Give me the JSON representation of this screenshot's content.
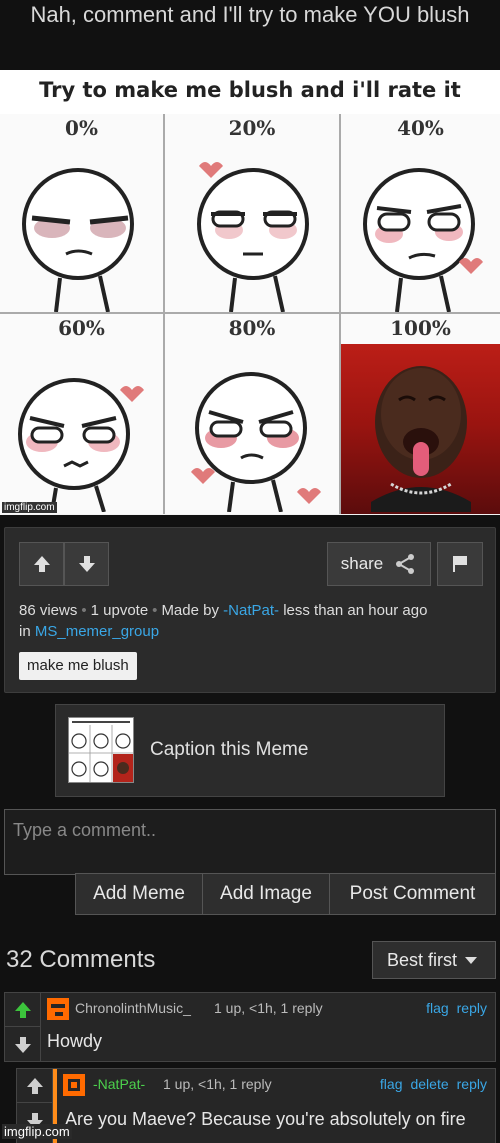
{
  "post": {
    "title": "Nah, comment and I'll try to make YOU blush"
  },
  "meme": {
    "header": "Try to make me blush and i'll rate it",
    "cells": [
      {
        "pct": "0%"
      },
      {
        "pct": "20%"
      },
      {
        "pct": "40%"
      },
      {
        "pct": "60%"
      },
      {
        "pct": "80%"
      },
      {
        "pct": "100%"
      }
    ],
    "watermark": "imgflip.com"
  },
  "info": {
    "share_label": "share",
    "views": "86 views",
    "upvotes": "1 upvote",
    "made_by_prefix": "Made by",
    "author": "-NatPat-",
    "time": "less than an hour ago",
    "in_prefix": "in",
    "group": "MS_memer_group",
    "tag": "make me blush"
  },
  "caption": {
    "label": "Caption this Meme"
  },
  "comment_form": {
    "placeholder": "Type a comment..",
    "add_meme": "Add Meme",
    "add_image": "Add Image",
    "post_comment": "Post Comment"
  },
  "comments_header": {
    "count_label": "32 Comments",
    "sort_value": "Best first"
  },
  "comments": [
    {
      "user": "ChronolinthMusic_",
      "stats": "1 up, <1h, 1 reply",
      "links": [
        "flag",
        "reply"
      ],
      "text": "Howdy",
      "user_color": "#bbbbbb",
      "avatar_color": "#ff6a00"
    },
    {
      "user": "-NatPat-",
      "stats": "1 up, <1h, 1 reply",
      "links": [
        "flag",
        "delete",
        "reply"
      ],
      "text": "Are you Maeve? Because you're absolutely on fire",
      "user_color": "#4cd14c",
      "avatar_color": "#ff6a00"
    }
  ],
  "footer_watermark": "imgflip.com"
}
